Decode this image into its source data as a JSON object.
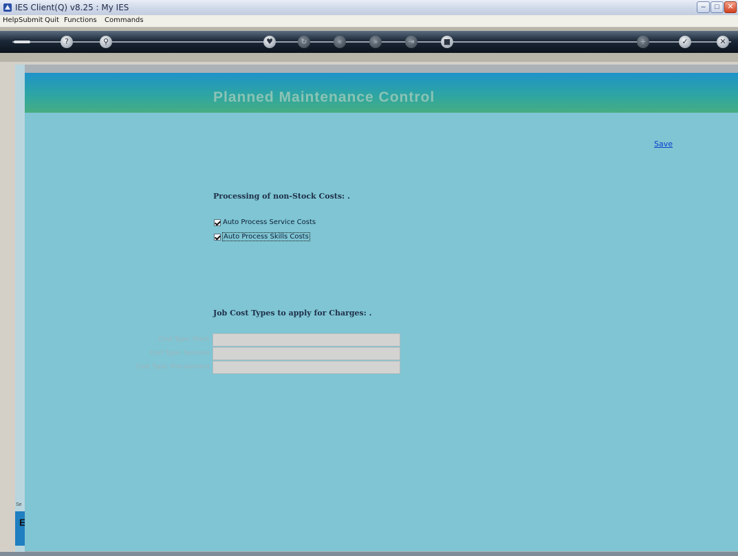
{
  "window": {
    "title": "IES Client(Q) v8.25 : My IES",
    "minimize_glyph": "–",
    "maximize_glyph": "□",
    "close_glyph": "✕"
  },
  "menu": [
    "Help",
    "Submit",
    "Quit",
    "Functions",
    "Commands"
  ],
  "toolbar": {
    "buttons": [
      {
        "icon": "key-icon",
        "glyph": ""
      },
      {
        "icon": "help-icon",
        "glyph": "?"
      },
      {
        "icon": "search-icon",
        "glyph": "⚲"
      },
      {
        "icon": "heart-icon",
        "glyph": "♥"
      },
      {
        "icon": "refresh-icon",
        "glyph": "↻"
      },
      {
        "icon": "rewind-icon",
        "glyph": "«"
      },
      {
        "icon": "forward-icon",
        "glyph": "»"
      },
      {
        "icon": "skip-icon",
        "glyph": "⇥"
      },
      {
        "icon": "stop-icon",
        "glyph": "■"
      },
      {
        "icon": "add-icon",
        "glyph": "+"
      },
      {
        "icon": "ok-icon",
        "glyph": "✓"
      },
      {
        "icon": "cancel-icon",
        "glyph": "✕"
      }
    ]
  },
  "panel": {
    "title": "Planned Maintenance Control",
    "save_label": "Save",
    "section1_title": "Processing of non-Stock Costs: .",
    "checkboxes": [
      {
        "label": "Auto Process Service Costs",
        "checked": true
      },
      {
        "label": "Auto Process Skills Costs",
        "checked": true
      }
    ],
    "section2_title": "Job Cost Types to apply for Charges: .",
    "fields": [
      {
        "label": "Cost Type: Stock",
        "value": ""
      },
      {
        "label": "Cost Type: Services",
        "value": ""
      },
      {
        "label": "Cost Type: Procurement",
        "value": ""
      }
    ]
  },
  "gutter": {
    "tiny_text": "Se",
    "letter": "E"
  },
  "colors": {
    "panel_bg": "#7fc5d3",
    "header_start": "#1e93c9",
    "header_end": "#47ad82",
    "link": "#0b3fcf"
  }
}
